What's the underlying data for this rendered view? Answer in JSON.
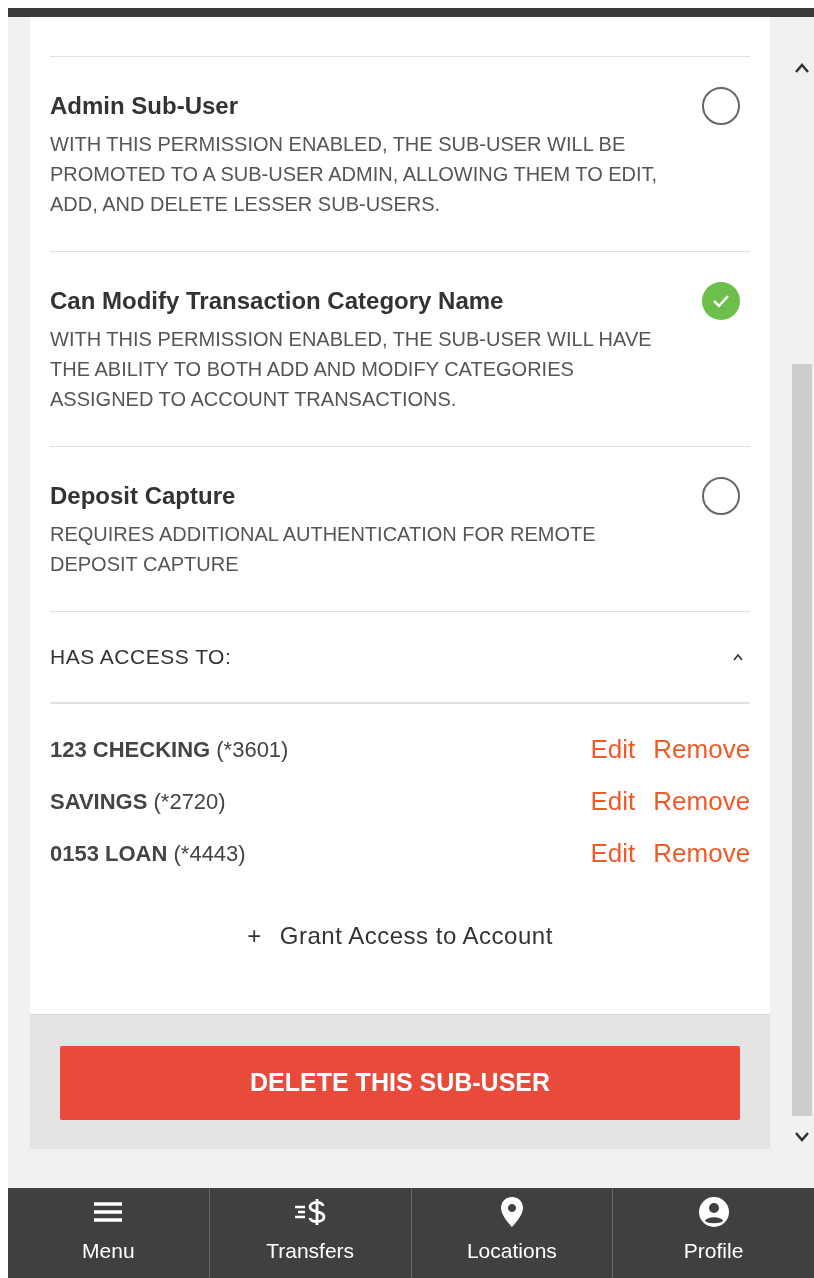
{
  "permissions": [
    {
      "title": "Admin Sub-User",
      "description": "WITH THIS PERMISSION ENABLED, THE SUB-USER WILL BE PROMOTED TO A SUB-USER ADMIN, ALLOWING THEM TO EDIT, ADD, AND DELETE LESSER SUB-USERS.",
      "checked": false
    },
    {
      "title": "Can Modify Transaction Category Name",
      "description": "WITH THIS PERMISSION ENABLED, THE SUB-USER WILL HAVE THE ABILITY TO BOTH ADD AND MODIFY CATEGORIES ASSIGNED TO ACCOUNT TRANSACTIONS.",
      "checked": true
    },
    {
      "title": "Deposit Capture",
      "description": "REQUIRES ADDITIONAL AUTHENTICATION FOR REMOTE DEPOSIT CAPTURE",
      "checked": false
    }
  ],
  "access": {
    "heading": "HAS ACCESS TO:",
    "expanded": true,
    "accounts": [
      {
        "name": "123 CHECKING",
        "number": "(*3601)",
        "edit": "Edit",
        "remove": "Remove"
      },
      {
        "name": "SAVINGS",
        "number": "(*2720)",
        "edit": "Edit",
        "remove": "Remove"
      },
      {
        "name": "0153 LOAN",
        "number": "(*4443)",
        "edit": "Edit",
        "remove": "Remove"
      }
    ],
    "grant_icon": "+",
    "grant": "Grant Access to Account"
  },
  "delete_button": "DELETE THIS SUB-USER",
  "nav": [
    {
      "kind": "menu",
      "label": "Menu"
    },
    {
      "kind": "transfers",
      "label": "Transfers"
    },
    {
      "kind": "locations",
      "label": "Locations"
    },
    {
      "kind": "profile",
      "label": "Profile"
    }
  ]
}
